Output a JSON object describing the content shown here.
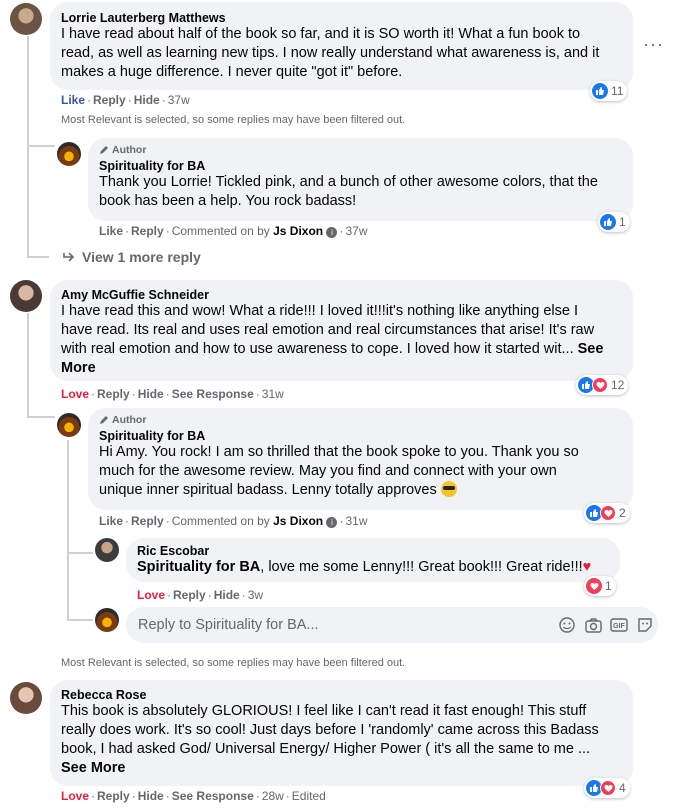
{
  "colors": {
    "like_blue": "#1877f2",
    "love_red": "#f33e58",
    "bubble_bg": "#f0f2f5",
    "meta_gray": "#65676b"
  },
  "actions": {
    "like": "Like",
    "love": "Love",
    "reply": "Reply",
    "hide": "Hide",
    "see_response": "See Response",
    "commented_on_by": "Commented on by",
    "author": "Author",
    "see_more": "See More",
    "edited": "Edited"
  },
  "filter_notice": "Most Relevant is selected, so some replies may have been filtered out.",
  "comments": [
    {
      "name": "Lorrie Lauterberg Matthews",
      "lines": [
        "I have read about half of the book so far, and it is SO worth it! What a fun book to",
        "read, as well as learning new tips. I now really understand what awareness is, and it",
        "makes a huge difference. I never quite \"got it\" before."
      ],
      "time": "37w",
      "reaction_count": "11",
      "replies": [
        {
          "name": "Spirituality for BA",
          "lines": [
            "Thank you Lorrie! Tickled pink, and a bunch of other awesome colors, that the",
            "book has been a help. You rock badass!"
          ],
          "commented_by": "Js Dixon",
          "time": "37w",
          "reaction_count": "1"
        }
      ],
      "view_more": "View 1 more reply"
    },
    {
      "name": "Amy McGuffie Schneider",
      "lines": [
        "I have read this and wow! What a ride!!! I loved it!!!it's nothing like anything else I",
        "have read. Its real and uses real emotion and real circumstances that arise! It's raw",
        "with real emotion and how to use awareness to cope. I loved how it started wit..."
      ],
      "time": "31w",
      "reaction_count": "12",
      "replies": [
        {
          "name": "Spirituality for BA",
          "lines": [
            "Hi Amy. You rock! I am so thrilled that the book spoke to you. Thank you so",
            "much for the awesome review. May you find and connect with your own",
            "unique inner spiritual badass. Lenny totally approves"
          ],
          "commented_by": "Js Dixon",
          "time": "31w",
          "reaction_count": "2"
        },
        {
          "name": "Ric Escobar",
          "mention": "Spirituality for BA",
          "text": ", love me some Lenny!!! Great book!!! Great ride!!!",
          "time": "3w",
          "reaction_count": "1"
        }
      ],
      "reply_placeholder": "Reply to Spirituality for BA..."
    },
    {
      "name": "Rebecca Rose",
      "lines": [
        "This book is absolutely GLORIOUS! I feel like I can't read it fast enough! This stuff",
        "really does work. It's so cool! Just days before I 'randomly' came across this Badass",
        "book, I had asked God/ Universal Energy/ Higher Power ( it's all the same to me ..."
      ],
      "time": "28w",
      "reaction_count": "4"
    }
  ]
}
